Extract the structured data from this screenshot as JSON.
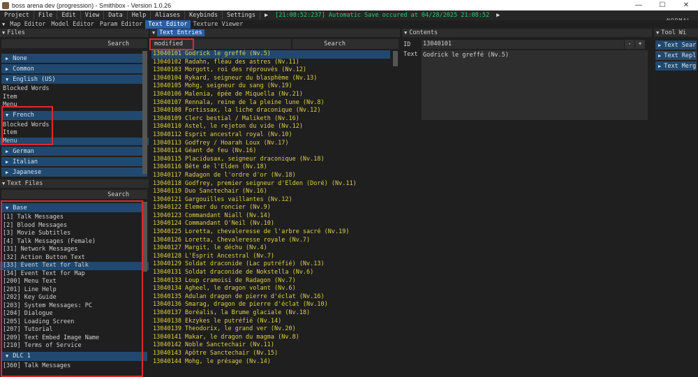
{
  "window": {
    "title": "boss arena dev (progression) - Smithbox - Version 1.0.26",
    "minimize": "—",
    "maximize": "☐",
    "close": "✕"
  },
  "menubar": {
    "items": [
      "Project",
      "File",
      "Edit",
      "View",
      "Data",
      "Help",
      "Aliases",
      "Keybinds",
      "Settings"
    ],
    "play_icon": "▶",
    "status": "[21:08:52:237] Automatic Save occured at 04/28/2025 21:08:52",
    "play_icon2": "▶",
    "mode": "NORMAL"
  },
  "editor_tabs": [
    "Map Editor",
    "Model Editor",
    "Param Editor",
    "Text Editor",
    "Texture Viewer"
  ],
  "files_panel": {
    "header": "Files",
    "search_label": "Search",
    "categories": [
      {
        "label": "None",
        "expanded": false,
        "children": []
      },
      {
        "label": "Common",
        "expanded": false,
        "children": []
      },
      {
        "label": "English (US)",
        "expanded": true,
        "children": [
          "Blocked Words",
          "Item",
          "Menu"
        ]
      },
      {
        "label": "French",
        "expanded": true,
        "children": [
          "Blocked Words",
          "Item",
          "Menu"
        ]
      },
      {
        "label": "German",
        "expanded": false,
        "children": []
      },
      {
        "label": "Italian",
        "expanded": false,
        "children": []
      },
      {
        "label": "Japanese",
        "expanded": false,
        "children": []
      }
    ]
  },
  "text_files_panel": {
    "header": "Text Files",
    "search_label": "Search",
    "groups": [
      {
        "label": "Base",
        "items": [
          "[1] Talk Messages",
          "[2] Blood Messages",
          "[3] Movie Subtitles",
          "[4] Talk Messages (Female)",
          "[31] Network Messages",
          "[32] Action Button Text",
          "[33] Event Text for Talk",
          "[34] Event Text for Map",
          "[200] Menu Text",
          "[201] Line Help",
          "[202] Key Guide",
          "[203] System Messages: PC",
          "[204] Dialogue",
          "[205] Loading Screen",
          "[207] Tutorial",
          "[209] Text Embed Image Name",
          "[210] Terms of Service"
        ]
      },
      {
        "label": "DLC 1",
        "items": [
          "[360] Talk Messages"
        ]
      }
    ]
  },
  "entries_panel": {
    "header": "Text Entries",
    "filter_value": "modified",
    "search_label": "Search",
    "entries": [
      "13040101 Godrick le greffé (Nv.5)",
      "13040102 Radahn, fléau des astres (Nv.11)",
      "13040103 Morgott, roi des réprouvés (Nv.12)",
      "13040104 Rykard, seigneur du blasphème (Nv.13)",
      "13040105 Mohg, seigneur du sang (Nv.19)",
      "13040106 Malenia, épée de Miquella (Nv.21)",
      "13040107 Rennala, reine de la pleine lune (Nv.8)",
      "13040108 Fortissax, la liche draconique (Nv.12)",
      "13040109 Clerc bestial / Maliketh (Nv.16)",
      "13040110 Astel, le rejeton du vide (Nv.12)",
      "13040112 Esprit ancestral royal (Nv.10)",
      "13040113 Godfrey / Hoarah Loux (Nv.17)",
      "13040114 Géant de feu (Nv.16)",
      "13040115 Placidusax, seigneur draconique (Nv.18)",
      "13040116 Bête de l'Elden (Nv.18)",
      "13040117 Radagon de l'ordre d'or (Nv.18)",
      "13040118 Godfrey, premier seigneur d'Elden (Doré) (Nv.11)",
      "13040119 Duo Sanctechair (Nv.16)",
      "13040121 Gargouilles vaillantes (Nv.12)",
      "13040122 Elemer du roncier (Nv.9)",
      "13040123 Commandant Niall (Nv.14)",
      "13040124 Commandant O'Neil (Nv.10)",
      "13040125 Loretta, chevaleresse de l'arbre sacré (Nv.19)",
      "13040126 Loretta, Chevaleresse royale (Nv.7)",
      "13040127 Margit, le déchu (Nv.4)",
      "13040128 L'Esprit Ancestral (Nv.7)",
      "13040129 Soldat draconide (Lac putréfié) (Nv.13)",
      "13040131 Soldat draconide de Nokstella (Nv.6)",
      "13040133 Loup cramoisi de Radagon (Nv.7)",
      "13040134 Agheel, le dragon volant (Nv.6)",
      "13040135 Adulan dragon de pierre d'éclat (Nv.16)",
      "13040136 Smarag, dragon de pierre d'éclat (Nv.10)",
      "13040137 Boréalis, la Brume glaciale (Nv.18)",
      "13040138 Ekzykes le putréfié (Nv.14)",
      "13040139 Theodorix, le grand ver (Nv.20)",
      "13040141 Makar, le dragon du magma (Nv.8)",
      "13040142 Noble Sanctechair (Nv.11)",
      "13040143 Apôtre Sanctechair (Nv.15)",
      "13040144 Mohg, le présage (Nv.14)"
    ]
  },
  "contents_panel": {
    "header": "Contents",
    "id_label": "ID",
    "id_value": "13040101",
    "minus": "-",
    "plus": "+",
    "text_label": "Text",
    "text_value": "Godrick le greffé (Nv.5)"
  },
  "tool_panel": {
    "header": "Tool Wi",
    "items": [
      "Text Sear",
      "Text Repl",
      "Text Merg"
    ]
  }
}
